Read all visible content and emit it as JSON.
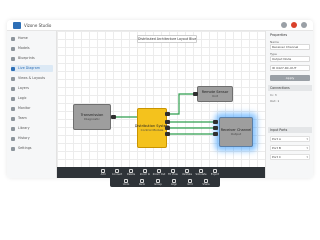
{
  "app": {
    "title": "Vizone Studio"
  },
  "colors": {
    "accent": "#2d6fb6",
    "node_gray": "#9e9e9e",
    "node_yellow": "#f4c21d",
    "glow": "#2896ff",
    "toolbar": "#2e3338"
  },
  "sidebar": {
    "items": [
      {
        "icon": "home-icon",
        "label": "Home"
      },
      {
        "icon": "folder-icon",
        "label": "Models"
      },
      {
        "icon": "blueprint-icon",
        "label": "Blueprints"
      },
      {
        "icon": "diagram-icon",
        "label": "Live Diagram"
      },
      {
        "icon": "layout-icon",
        "label": "Views & Layouts"
      },
      {
        "icon": "layers-icon",
        "label": "Layers"
      },
      {
        "icon": "logic-icon",
        "label": "Logic"
      },
      {
        "icon": "monitor-icon",
        "label": "Monitor"
      },
      {
        "icon": "team-icon",
        "label": "Team"
      },
      {
        "icon": "library-icon",
        "label": "Library"
      },
      {
        "icon": "history-icon",
        "label": "History"
      },
      {
        "icon": "settings-icon",
        "label": "Settings"
      }
    ]
  },
  "canvas": {
    "banner": "Distributed Architecture Layout Blueprint",
    "nodes": [
      {
        "title": "Transmission",
        "subtitle": "Diagnostic"
      },
      {
        "title": "Distribution System",
        "subtitle": "Control Module"
      },
      {
        "title": "Remote Sensor",
        "subtitle": "Unit"
      },
      {
        "title": "Receiver Channel",
        "subtitle": "Output"
      }
    ]
  },
  "toolbar": {
    "tools": [
      {
        "icon": "add-icon",
        "label": "Add"
      },
      {
        "icon": "connect-icon",
        "label": "Connect"
      },
      {
        "icon": "delete-icon",
        "label": "Delete"
      },
      {
        "icon": "zoom-in-icon",
        "label": "Zoom In"
      },
      {
        "icon": "zoom-out-icon",
        "label": "Zoom Out"
      },
      {
        "icon": "fit-icon",
        "label": "Fit View"
      },
      {
        "icon": "validate-icon",
        "label": "Validate"
      },
      {
        "icon": "simulate-icon",
        "label": "Simulate"
      },
      {
        "icon": "export-icon",
        "label": "Export"
      }
    ]
  },
  "footer": {
    "tools": [
      {
        "icon": "undo-icon",
        "label": "Undo"
      },
      {
        "icon": "redo-icon",
        "label": "Redo"
      },
      {
        "icon": "group-icon",
        "label": "Group"
      },
      {
        "icon": "align-icon",
        "label": "Align"
      },
      {
        "icon": "grid-icon",
        "label": "Grid"
      },
      {
        "icon": "share-icon",
        "label": "Share"
      }
    ]
  },
  "right_panel": {
    "heading": "Properties",
    "name_label": "Name",
    "name_value": "Receiver Channel",
    "type_label": "Type",
    "type_value": "Output Node",
    "id_value": "ID 0427-RC-OUT",
    "apply_button": "Apply",
    "section1": "Connections",
    "conn_in": "In: 3",
    "conn_out": "Out: 1",
    "section2": "Input Ports",
    "ports": [
      "Port A",
      "Port B",
      "Port C"
    ]
  }
}
